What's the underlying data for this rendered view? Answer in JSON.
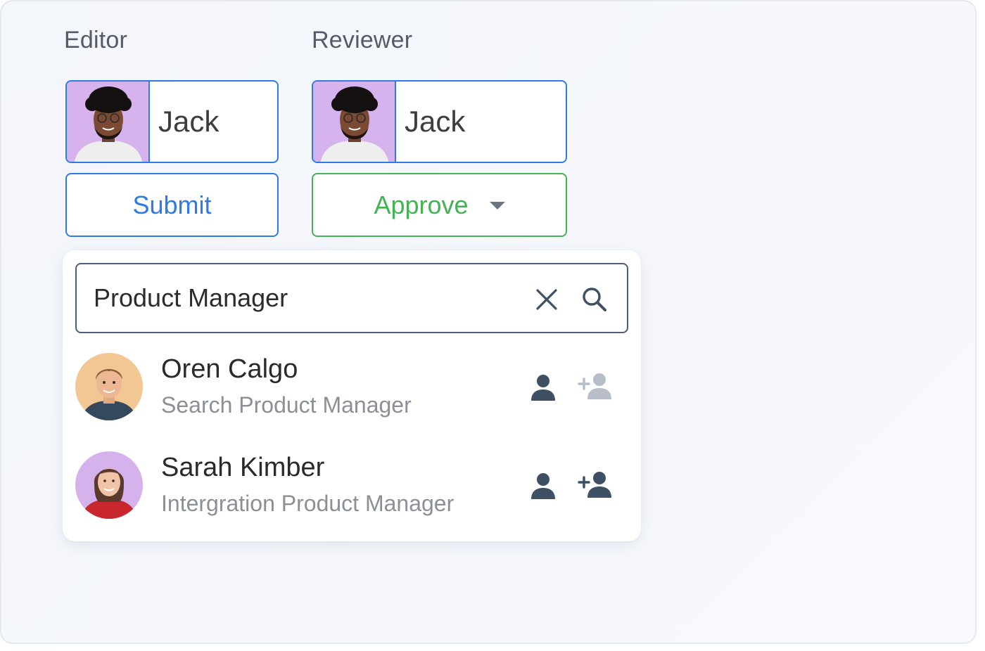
{
  "roles": {
    "editor": {
      "label": "Editor",
      "person_name": "Jack",
      "action_label": "Submit"
    },
    "reviewer": {
      "label": "Reviewer",
      "person_name": "Jack",
      "action_label": "Approve"
    }
  },
  "search": {
    "value": "Product Manager",
    "clear_icon": "close-icon",
    "search_icon": "search-icon"
  },
  "results": [
    {
      "name": "Oren Calgo",
      "title": "Search Product Manager",
      "add_state": "disabled",
      "avatar_bg": "#f2c794"
    },
    {
      "name": "Sarah Kimber",
      "title": "Intergration Product Manager",
      "add_state": "enabled",
      "avatar_bg": "#d6b2ec"
    }
  ],
  "colors": {
    "primary_blue": "#2f7be6",
    "approve_green": "#43b353",
    "search_border": "#4a6079",
    "icon_dark": "#3e5063",
    "icon_disabled": "#b7bec8",
    "editor_avatar_bg": "#d7b3ee"
  }
}
